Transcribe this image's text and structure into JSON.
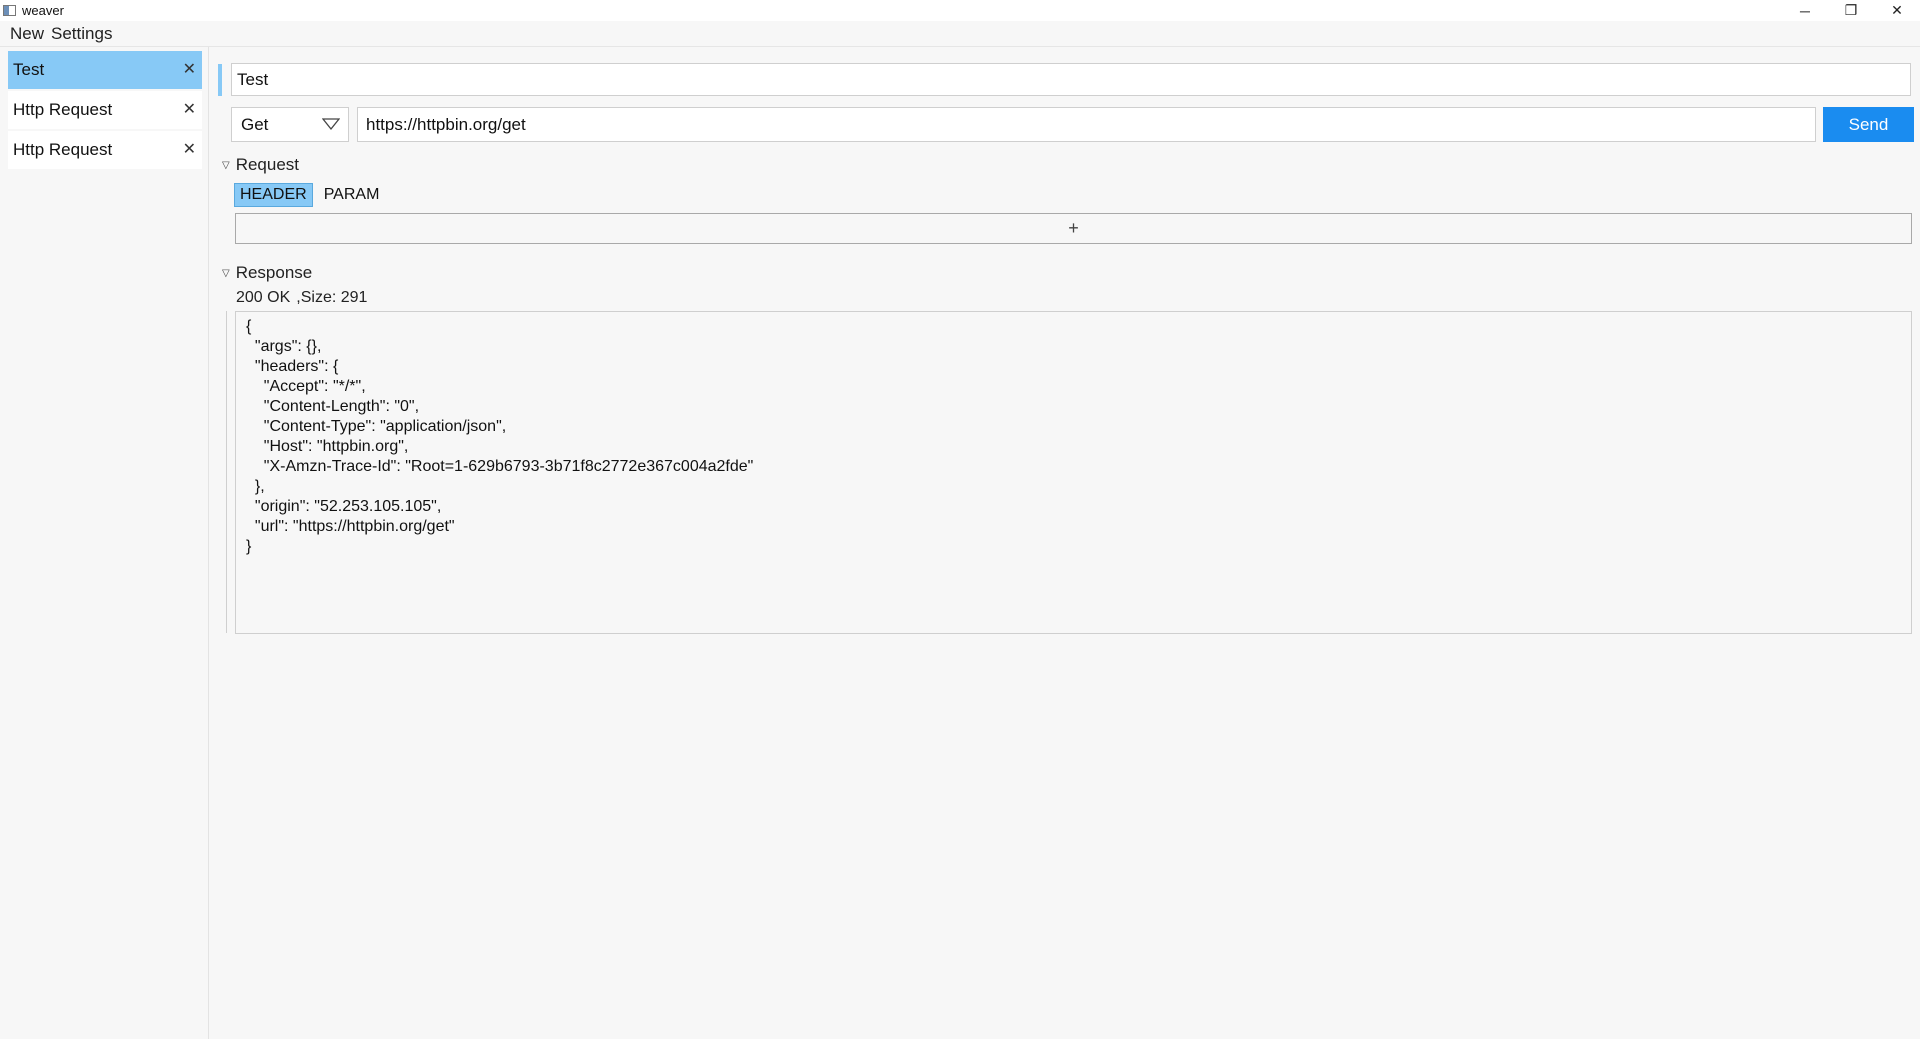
{
  "window": {
    "title": "weaver",
    "controls": {
      "minimize": "─",
      "restore": "❐",
      "close": "✕"
    }
  },
  "menu": {
    "items": [
      "New",
      "Settings"
    ]
  },
  "sidebar": {
    "tabs": [
      {
        "label": "Test",
        "active": true
      },
      {
        "label": "Http Request",
        "active": false
      },
      {
        "label": "Http Request",
        "active": false
      }
    ],
    "close_glyph": "✕"
  },
  "request_editor": {
    "name": "Test",
    "method": "Get",
    "url": "https://httpbin.org/get",
    "send_label": "Send",
    "request_section_label": "Request",
    "subtabs": [
      {
        "label": "HEADER",
        "active": true
      },
      {
        "label": "PARAM",
        "active": false
      }
    ],
    "add_glyph": "+",
    "response_section_label": "Response",
    "status": "200 OK",
    "size": ",Size: 291",
    "body": "{\n  \"args\": {},\n  \"headers\": {\n    \"Accept\": \"*/*\",\n    \"Content-Length\": \"0\",\n    \"Content-Type\": \"application/json\",\n    \"Host\": \"httpbin.org\",\n    \"X-Amzn-Trace-Id\": \"Root=1-629b6793-3b71f8c2772e367c004a2fde\"\n  },\n  \"origin\": \"52.253.105.105\",\n  \"url\": \"https://httpbin.org/get\"\n}"
  },
  "colors": {
    "accent": "#87c9f6",
    "send_button": "#1a8cf0",
    "background": "#f7f7f7"
  },
  "icons": {
    "method_dropdown": "chevron-down-icon",
    "section_toggle": "triangle-down-icon"
  }
}
